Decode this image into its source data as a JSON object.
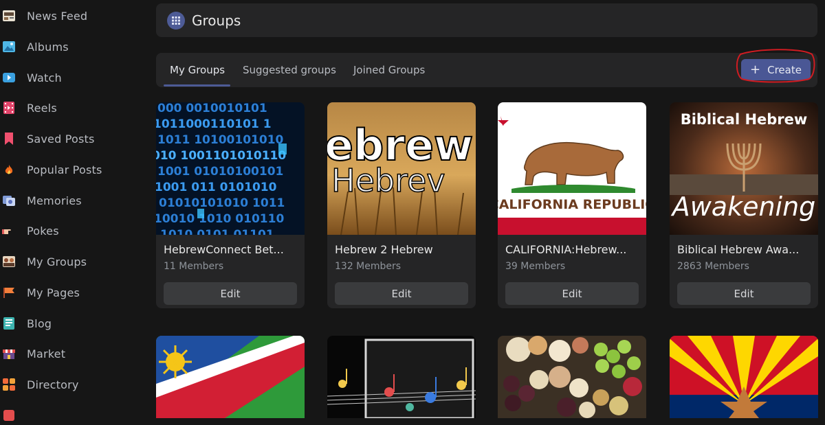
{
  "sidebar": {
    "items": [
      {
        "label": "News Feed",
        "icon": "news-feed-icon"
      },
      {
        "label": "Albums",
        "icon": "albums-icon"
      },
      {
        "label": "Watch",
        "icon": "watch-icon"
      },
      {
        "label": "Reels",
        "icon": "reels-icon"
      },
      {
        "label": "Saved Posts",
        "icon": "bookmark-icon"
      },
      {
        "label": "Popular Posts",
        "icon": "fire-icon"
      },
      {
        "label": "Memories",
        "icon": "memories-icon"
      },
      {
        "label": "Pokes",
        "icon": "poke-hand-icon"
      },
      {
        "label": "My Groups",
        "icon": "groups-icon"
      },
      {
        "label": "My Pages",
        "icon": "flag-icon"
      },
      {
        "label": "Blog",
        "icon": "blog-icon"
      },
      {
        "label": "Market",
        "icon": "market-icon"
      },
      {
        "label": "Directory",
        "icon": "directory-icon"
      }
    ]
  },
  "header": {
    "title": "Groups",
    "icon": "groups-grid-icon"
  },
  "tabs": [
    {
      "label": "My Groups",
      "active": true
    },
    {
      "label": "Suggested groups",
      "active": false
    },
    {
      "label": "Joined Groups",
      "active": false
    }
  ],
  "create_button": {
    "label": "Create",
    "icon": "plus-icon",
    "highlight_color": "#d01c22"
  },
  "groups": [
    {
      "name": "HebrewConnect Bet...",
      "members": "11 Members",
      "edit_label": "Edit",
      "image": "binary-code-image"
    },
    {
      "name": "Hebrew 2 Hebrew",
      "members": "132 Members",
      "edit_label": "Edit",
      "image": "hebrew-wheat-image",
      "image_text": [
        "ebrew",
        "Hebrev"
      ]
    },
    {
      "name": "CALIFORNIA:Hebrew...",
      "members": "39 Members",
      "edit_label": "Edit",
      "image": "california-flag-image",
      "image_text": "CALIFORNIA  REPUBLIC"
    },
    {
      "name": "Biblical Hebrew Awa...",
      "members": "2863 Members",
      "edit_label": "Edit",
      "image": "biblical-hebrew-image",
      "image_text": [
        "Biblical Hebrew",
        "Awakening"
      ]
    }
  ],
  "second_row": [
    {
      "image": "namibia-flag-image"
    },
    {
      "image": "music-notes-image"
    },
    {
      "image": "fruit-platter-image"
    },
    {
      "image": "arizona-flag-image"
    }
  ],
  "colors": {
    "accent": "#4a5795",
    "panel": "#252526",
    "background": "#161616"
  }
}
